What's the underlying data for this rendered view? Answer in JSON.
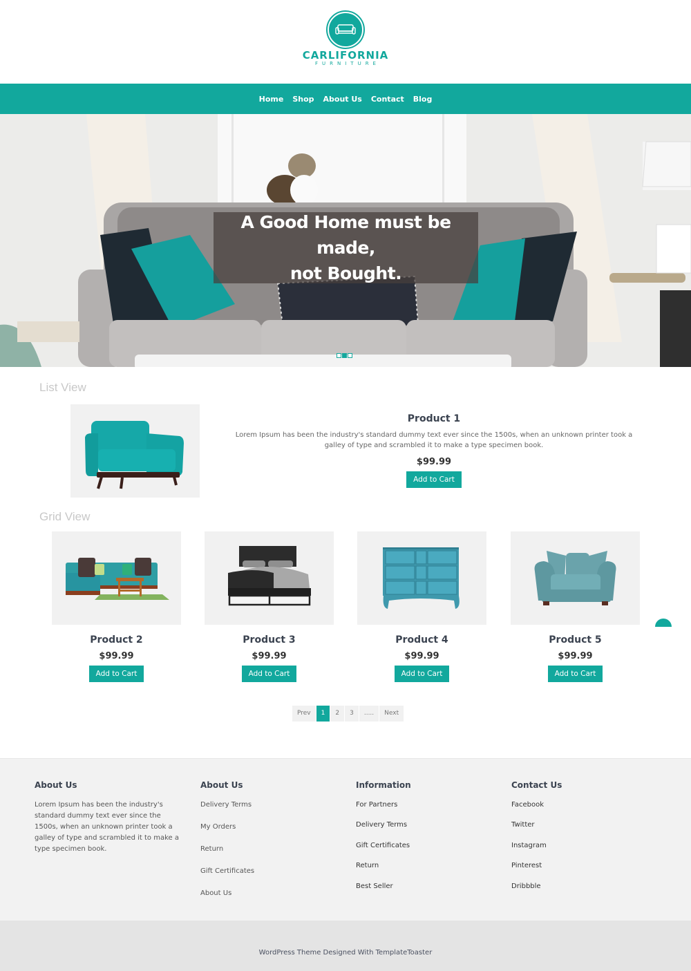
{
  "brand": {
    "name": "CARLIFORNIA",
    "tagline": "FURNITURE",
    "logo_icon": "sofa-icon",
    "accent_color": "#12a89d"
  },
  "nav": {
    "items": [
      {
        "label": "Home"
      },
      {
        "label": "Shop"
      },
      {
        "label": "About Us"
      },
      {
        "label": "Contact"
      },
      {
        "label": "Blog"
      }
    ]
  },
  "hero": {
    "line1": "A Good Home must be made,",
    "line2": "not Bought.",
    "slides": 3,
    "active_slide": 2
  },
  "list_view": {
    "label": "List View",
    "product": {
      "title": "Product 1",
      "description": "Lorem Ipsum has been the industry's standard dummy text ever since the 1500s, when an unknown printer took a galley of type and scrambled it to make a type specimen book.",
      "price": "$99.99",
      "button": "Add to Cart",
      "image": "teal-armchair"
    }
  },
  "grid_view": {
    "label": "Grid View",
    "products": [
      {
        "title": "Product 2",
        "price": "$99.99",
        "button": "Add to Cart",
        "image": "teal-sectional-sofa"
      },
      {
        "title": "Product 3",
        "price": "$99.99",
        "button": "Add to Cart",
        "image": "black-bed"
      },
      {
        "title": "Product 4",
        "price": "$99.99",
        "button": "Add to Cart",
        "image": "blue-dresser"
      },
      {
        "title": "Product 5",
        "price": "$99.99",
        "button": "Add to Cart",
        "image": "blue-loveseat"
      }
    ]
  },
  "pagination": {
    "prev": "Prev",
    "pages": [
      "1",
      "2",
      "3",
      "....."
    ],
    "active": "1",
    "next": "Next"
  },
  "footer": {
    "about": {
      "heading": "About Us",
      "text": "Lorem Ipsum has been the industry's standard dummy text ever since the 1500s, when an unknown printer took a galley of type and scrambled it to make a type specimen book."
    },
    "about_links": {
      "heading": "About Us",
      "items": [
        "Delivery Terms",
        "My Orders",
        "Return",
        "Gift Certificates",
        "About Us"
      ]
    },
    "information": {
      "heading": "Information",
      "items": [
        "For Partners",
        "Delivery Terms",
        "Gift Certificates",
        "Return",
        "Best Seller"
      ]
    },
    "contact": {
      "heading": "Contact Us",
      "items": [
        "Facebook",
        "Twitter",
        "Instagram",
        "Pinterest",
        "Dribbble"
      ]
    },
    "credit": "WordPress Theme Designed With TemplateToaster"
  }
}
